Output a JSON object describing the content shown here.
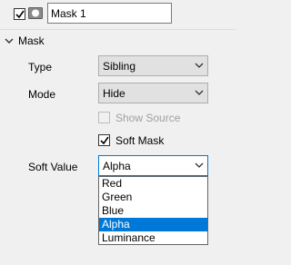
{
  "header": {
    "enabled": true,
    "mask_name": "Mask 1"
  },
  "section": {
    "title": "Mask",
    "expanded": true
  },
  "fields": {
    "type": {
      "label": "Type",
      "value": "Sibling"
    },
    "mode": {
      "label": "Mode",
      "value": "Hide"
    },
    "show_source": {
      "label": "Show Source",
      "checked": false,
      "enabled": false
    },
    "soft_mask": {
      "label": "Soft Mask",
      "checked": true
    },
    "soft_value": {
      "label": "Soft Value",
      "value": "Alpha"
    }
  },
  "dropdown": {
    "open": true,
    "options": [
      "Red",
      "Green",
      "Blue",
      "Alpha",
      "Luminance"
    ],
    "selected": "Alpha"
  },
  "colors": {
    "selection": "#0078d7",
    "background": "#f0f0f0"
  },
  "icons": [
    "checkbox-checked-icon",
    "mask-layer-icon",
    "chevron-down-icon",
    "collapse-arrow-icon"
  ]
}
